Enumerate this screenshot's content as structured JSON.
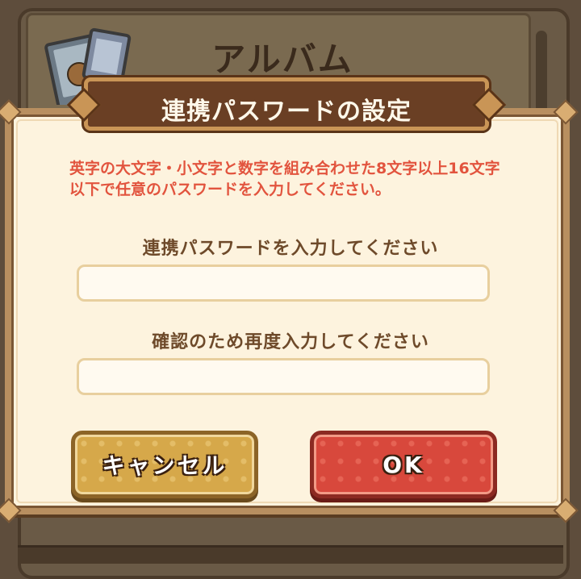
{
  "background": {
    "title": "アルバム"
  },
  "dialog": {
    "title": "連携パスワードの設定",
    "instruction": "英字の大文字・小文字と数字を組み合わせた8文字以上16文字以下で任意のパスワードを入力してください。",
    "password_label": "連携パスワードを入力してください",
    "password_value": "",
    "confirm_label": "確認のため再度入力してください",
    "confirm_value": "",
    "cancel_label": "キャンセル",
    "ok_label": "OK"
  },
  "colors": {
    "instruction_text": "#e2543e",
    "label_text": "#6e4a2a",
    "cancel_button": "#d6a84a",
    "ok_button": "#d8483c",
    "dialog_background": "#fdf3de",
    "plaque_background": "#6a3f24"
  },
  "icons": {
    "album": "album-book-icon"
  }
}
